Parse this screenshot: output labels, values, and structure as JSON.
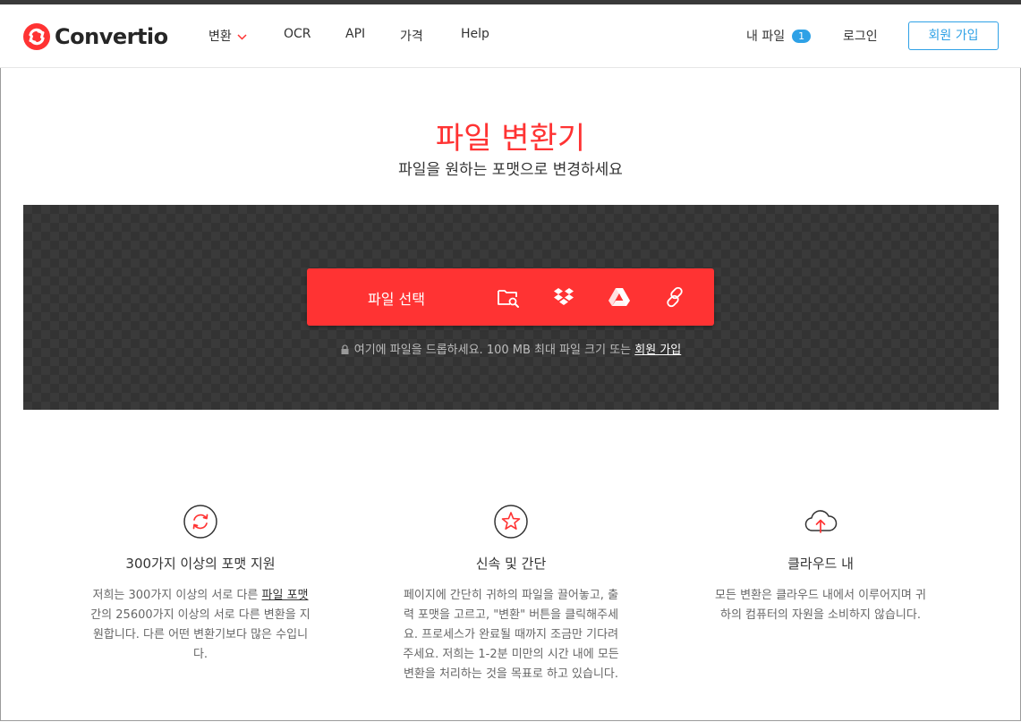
{
  "header": {
    "brand": "Convertio",
    "nav": [
      {
        "label": "변환"
      },
      {
        "label": "OCR"
      },
      {
        "label": "API"
      },
      {
        "label": "가격"
      },
      {
        "label": "Help"
      }
    ],
    "my_files_label": "내 파일",
    "my_files_count": "1",
    "login_label": "로그인",
    "signup_label": "회원 가입"
  },
  "hero": {
    "title": "파일 변환기",
    "subtitle": "파일을 원하는 포맷으로 변경하세요"
  },
  "upload": {
    "choose_label": "파일 선택",
    "sources": [
      "folder-search-icon",
      "dropbox-icon",
      "google-drive-icon",
      "link-icon"
    ],
    "drop_note": "여기에 파일을 드롭하세요. 100 MB 최대 파일 크기 또는",
    "drop_note_link": "회원 가입"
  },
  "features": [
    {
      "icon": "refresh-icon",
      "title": "300가지 이상의 포맷 지원",
      "desc_before": "저희는 300가지 이상의 서로 다른",
      "desc_link": "파일 포맷",
      "desc_after": "간의 25600가지 이상의 서로 다른 변환을 지원합니다. 다른 어떤 변환기보다 많은 수입니다."
    },
    {
      "icon": "star-icon",
      "title": "신속 및 간단",
      "desc": "페이지에 간단히 귀하의 파일을 끌어놓고, 출력 포맷을 고르고, \"변환\" 버튼을 클릭해주세요. 프로세스가 완료될 때까지 조금만 기다려주세요. 저희는 1-2분 미만의 시간 내에 모든 변환을 처리하는 것을 목표로 하고 있습니다."
    },
    {
      "icon": "cloud-upload-icon",
      "title": "클라우드 내",
      "desc": "모든 변환은 클라우드 내에서 이루어지며 귀하의 컴퓨터의 자원을 소비하지 않습니다."
    }
  ],
  "colors": {
    "accent": "#ff3333",
    "link_blue": "#2ea1e6",
    "upload_bg": "#3a3a3a"
  }
}
